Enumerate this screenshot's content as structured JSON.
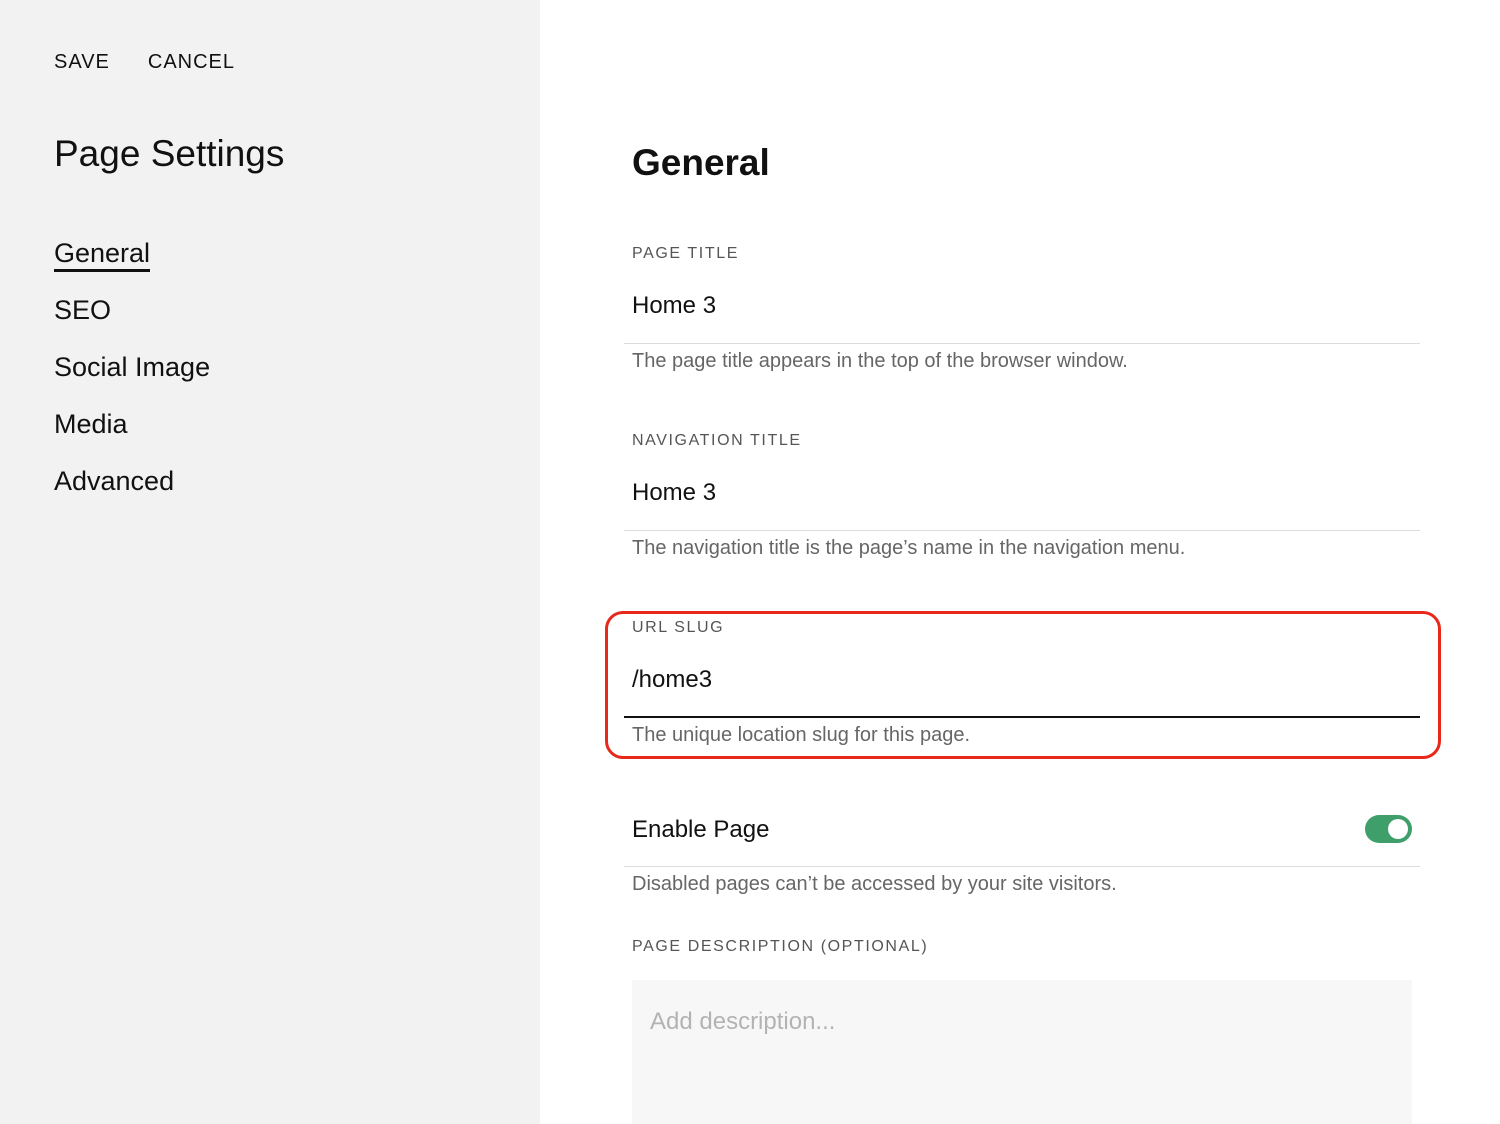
{
  "sidebar": {
    "actions": {
      "save": "SAVE",
      "cancel": "CANCEL"
    },
    "title": "Page Settings",
    "nav": [
      {
        "label": "General",
        "active": true
      },
      {
        "label": "SEO"
      },
      {
        "label": "Social Image"
      },
      {
        "label": "Media"
      },
      {
        "label": "Advanced"
      }
    ]
  },
  "main": {
    "title": "General",
    "page_title": {
      "label": "PAGE TITLE",
      "value": "Home 3",
      "help": "The page title appears in the top of the browser window."
    },
    "navigation_title": {
      "label": "NAVIGATION TITLE",
      "value": "Home 3",
      "help": "The navigation title is the page’s name in the navigation menu."
    },
    "url_slug": {
      "label": "URL SLUG",
      "value": "/home3",
      "help": "The unique location slug for this page."
    },
    "enable_page": {
      "label": "Enable Page",
      "enabled": true,
      "help": "Disabled pages can’t be accessed by your site visitors."
    },
    "page_description": {
      "label": "PAGE DESCRIPTION (OPTIONAL)",
      "placeholder": "Add description..."
    }
  },
  "colors": {
    "sidebar_bg": "#f2f2f2",
    "toggle_on": "#3e9f6a",
    "highlight": "#e8281a"
  }
}
